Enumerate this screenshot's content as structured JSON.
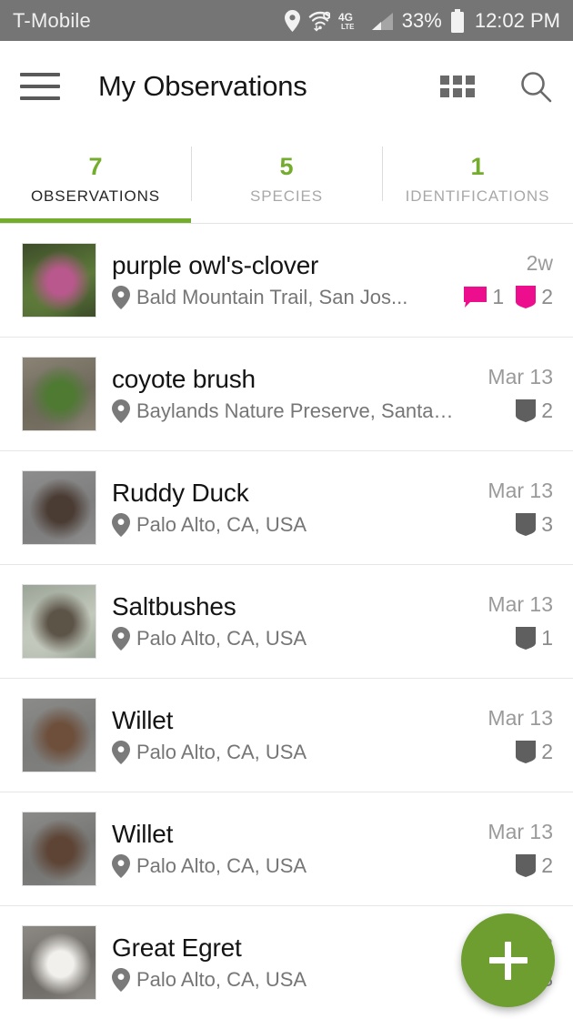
{
  "status_bar": {
    "carrier": "T-Mobile",
    "icons": [
      "location-icon",
      "wifi-icon",
      "4g-lte-icon",
      "signal-icon"
    ],
    "network_label": "4G",
    "network_sub": "LTE",
    "battery_percent": "33%",
    "battery_icon": "battery-icon",
    "clock": "12:02 PM",
    "bg_color": "#757575"
  },
  "app_bar": {
    "menu_icon": "hamburger-menu-icon",
    "title": "My Observations",
    "grid_icon": "grid-view-icon",
    "search_icon": "search-icon"
  },
  "tabs": {
    "accent_color": "#74ac2e",
    "active_index": 0,
    "items": [
      {
        "count": "7",
        "label": "OBSERVATIONS"
      },
      {
        "count": "5",
        "label": "SPECIES"
      },
      {
        "count": "1",
        "label": "IDENTIFICATIONS"
      }
    ]
  },
  "observations": [
    {
      "name": "purple owl's-clover",
      "place": "Bald Mountain Trail, San Jos...",
      "date": "2w",
      "thumb_colors": [
        "#3d4c2a",
        "#b8588c",
        "#5d7a3a"
      ],
      "thumb_kind": "pink-flower-photo",
      "stats": [
        {
          "icon": "comment-icon",
          "value": "1",
          "color": "#ec0e8c"
        },
        {
          "icon": "identification-shield-icon",
          "value": "2",
          "color": "#ec0e8c"
        }
      ]
    },
    {
      "name": "coyote brush",
      "place": "Baylands Nature Preserve, Santa C...",
      "date": "Mar 13",
      "thumb_colors": [
        "#8a8376",
        "#4e7a32",
        "#6f6a5c"
      ],
      "thumb_kind": "green-shrub-photo",
      "stats": [
        {
          "icon": "identification-shield-icon",
          "value": "2",
          "color": "#5f5f5f"
        }
      ]
    },
    {
      "name": "Ruddy Duck",
      "place": "Palo Alto, CA, USA",
      "date": "Mar 13",
      "thumb_colors": [
        "#8d8d8d",
        "#4a3b33",
        "#7e7e7e"
      ],
      "thumb_kind": "duck-on-water-photo",
      "stats": [
        {
          "icon": "identification-shield-icon",
          "value": "3",
          "color": "#5f5f5f"
        }
      ]
    },
    {
      "name": "Saltbushes",
      "place": "Palo Alto, CA, USA",
      "date": "Mar 13",
      "thumb_colors": [
        "#9aa496",
        "#5d5448",
        "#c3c9bd"
      ],
      "thumb_kind": "silver-foliage-photo",
      "stats": [
        {
          "icon": "identification-shield-icon",
          "value": "1",
          "color": "#5f5f5f"
        }
      ]
    },
    {
      "name": "Willet",
      "place": "Palo Alto, CA, USA",
      "date": "Mar 13",
      "thumb_colors": [
        "#8b8b89",
        "#6d4f3b",
        "#7c7c7a"
      ],
      "thumb_kind": "shorebird-photo",
      "stats": [
        {
          "icon": "identification-shield-icon",
          "value": "2",
          "color": "#5f5f5f"
        }
      ]
    },
    {
      "name": "Willet",
      "place": "Palo Alto, CA, USA",
      "date": "Mar 13",
      "thumb_colors": [
        "#8b8b89",
        "#5d4435",
        "#767674"
      ],
      "thumb_kind": "shorebird-feeding-photo",
      "stats": [
        {
          "icon": "identification-shield-icon",
          "value": "2",
          "color": "#5f5f5f"
        }
      ]
    },
    {
      "name": "Great Egret",
      "place": "Palo Alto, CA, USA",
      "date": "Mar 13",
      "thumb_colors": [
        "#8d8a85",
        "#f2f0ec",
        "#6f6c67"
      ],
      "thumb_kind": "white-egret-photo",
      "stats": [
        {
          "icon": "identification-shield-icon",
          "value": "3",
          "color": "#5f5f5f"
        }
      ]
    }
  ],
  "fab": {
    "icon": "plus-icon",
    "label": "Add observation",
    "color": "#6d9e2f"
  }
}
